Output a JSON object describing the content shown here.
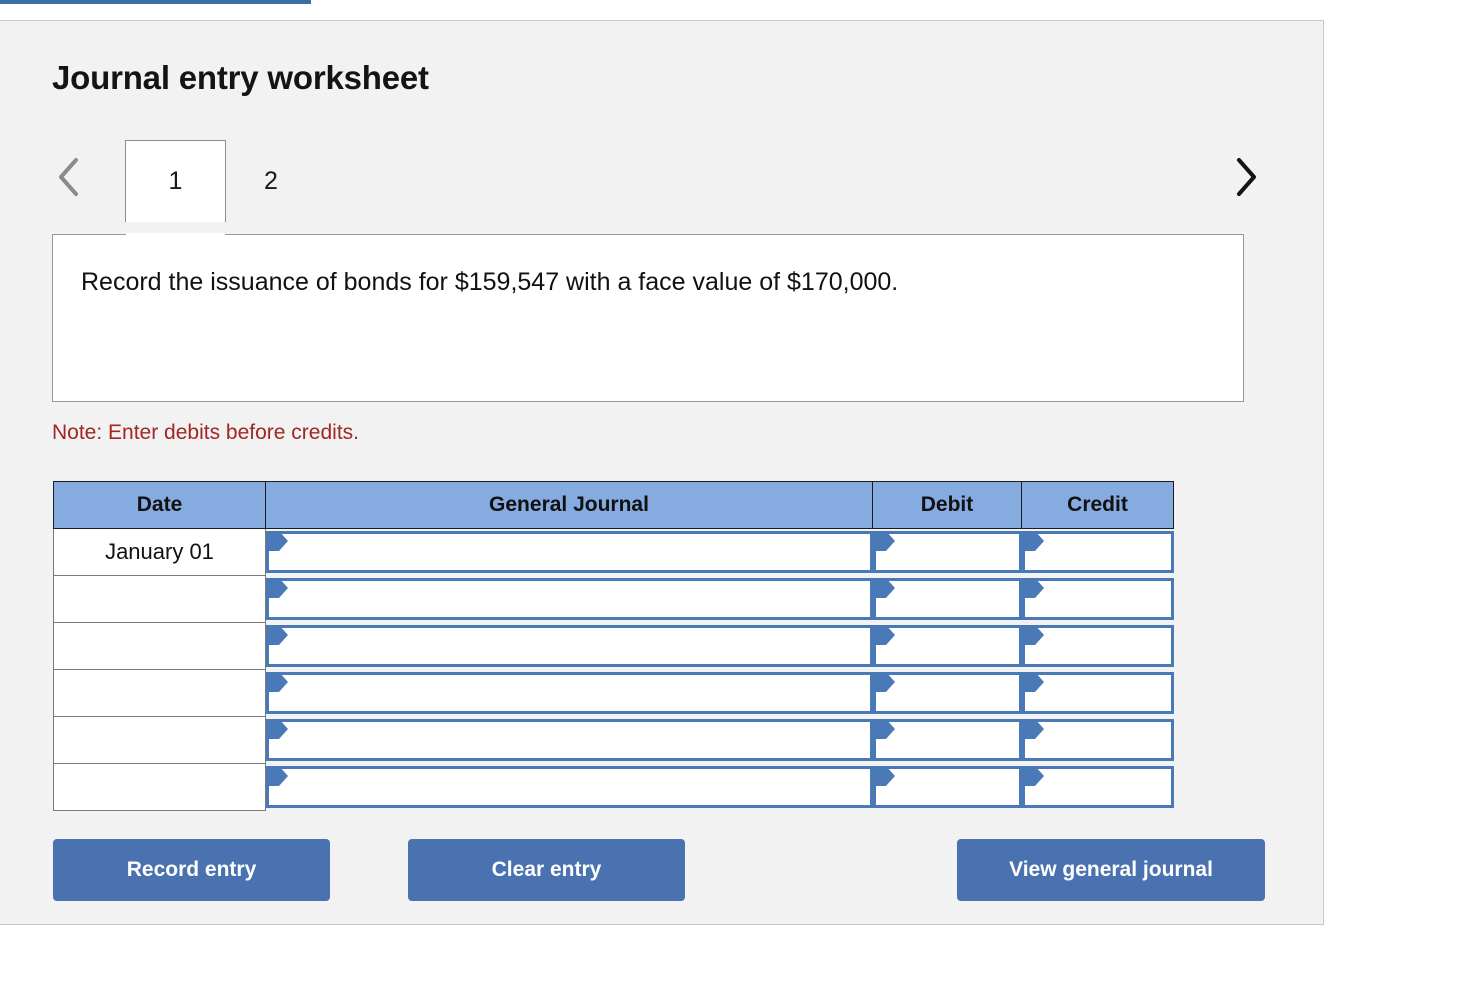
{
  "page": {
    "title": "Journal entry worksheet",
    "note": "Note: Enter debits before credits.",
    "prompt": "Record the issuance of bonds for $159,547 with a face value of $170,000."
  },
  "nav": {
    "prev_icon": "chevron-left-icon",
    "next_icon": "chevron-right-icon",
    "prev_enabled_color": "#8c8c8c",
    "next_enabled_color": "#141414"
  },
  "tabs": [
    {
      "label": "1",
      "active": true
    },
    {
      "label": "2",
      "active": false
    }
  ],
  "table": {
    "headers": [
      "Date",
      "General Journal",
      "Debit",
      "Credit"
    ],
    "rows": [
      {
        "date": "January 01",
        "general_journal": "",
        "debit": "",
        "credit": ""
      },
      {
        "date": "",
        "general_journal": "",
        "debit": "",
        "credit": ""
      },
      {
        "date": "",
        "general_journal": "",
        "debit": "",
        "credit": ""
      },
      {
        "date": "",
        "general_journal": "",
        "debit": "",
        "credit": ""
      },
      {
        "date": "",
        "general_journal": "",
        "debit": "",
        "credit": ""
      },
      {
        "date": "",
        "general_journal": "",
        "debit": "",
        "credit": ""
      }
    ]
  },
  "buttons": {
    "record": "Record entry",
    "clear": "Clear entry",
    "view": "View general journal"
  },
  "colors": {
    "header_blue": "#86abe0",
    "button_blue": "#4a72b0",
    "input_border_blue": "#4a79b8",
    "note_red": "#a02723",
    "card_bg": "#f2f2f2"
  }
}
